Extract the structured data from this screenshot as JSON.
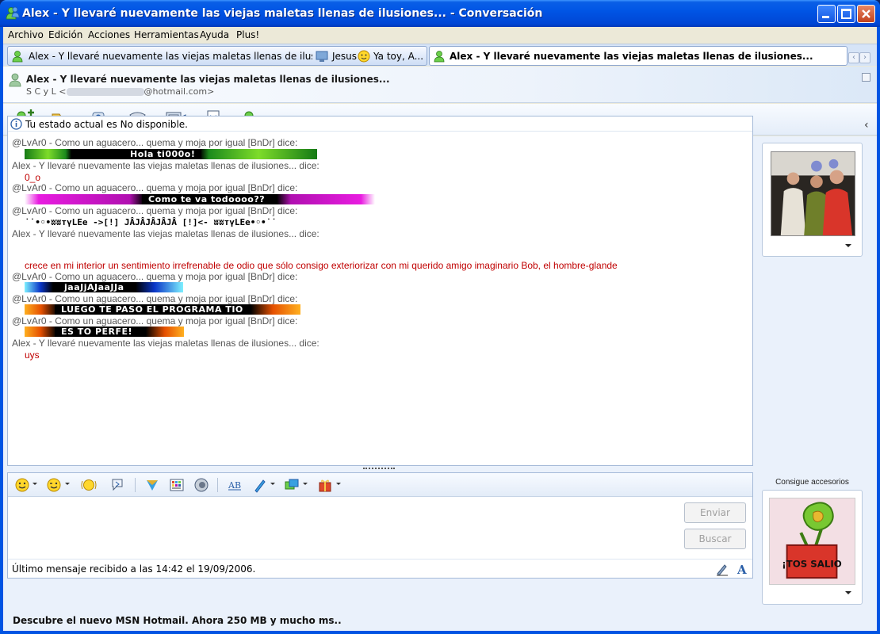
{
  "window": {
    "title": "Alex - Y llevaré nuevamente las viejas maletas llenas de ilusiones... - Conversación"
  },
  "menu": [
    "Archivo",
    "Edición",
    "Acciones",
    "Herramientas",
    "Ayuda",
    "Plus!"
  ],
  "tabs": [
    {
      "label": "Alex - Y llevaré nuevamente las viejas maletas llenas de ilusiones...,",
      "extra1": "Jesus",
      "extra2": "Ya toy, A...",
      "active": false
    },
    {
      "label": "Alex - Y llevaré nuevamente las viejas maletas llenas de ilusiones...",
      "active": true
    }
  ],
  "contact": {
    "name": "Alex - Y llevaré nuevamente las viejas maletas llenas de ilusiones...",
    "email_prefix": "S C y L",
    "email_domain": "@hotmail.com>"
  },
  "toolbar_icons": [
    "add-contact-icon",
    "send-files-icon",
    "webcam-icon",
    "call-icon",
    "video-icon",
    "activities-icon",
    "block-icon"
  ],
  "status_message": "Tu estado actual es No disponible.",
  "messages": [
    {
      "sender": "@LvAr0 - Como un aguacero... quema y moja por igual [BnDr] dice:",
      "text": "Hola ti000o!",
      "style": "green"
    },
    {
      "sender": "Alex - Y llevaré nuevamente las viejas maletas llenas de ilusiones... dice:",
      "text": "0_o",
      "style": "plain"
    },
    {
      "sender": "@LvAr0 - Como un aguacero... quema y moja por igual [BnDr] dice:",
      "text": "Como te va todoooo??",
      "style": "magenta"
    },
    {
      "sender": "@LvAr0 - Como un aguacero... quema y moja por igual [BnDr] dice:",
      "text": "˙˙•◦•ʬʬтүLEe ->[!]  JÂJÂJÂJÂJÂ  [!]<- ʬʬтүLEe•◦•˙˙",
      "style": "mono"
    },
    {
      "sender": "Alex - Y llevaré nuevamente las viejas maletas llenas de ilusiones... dice:",
      "text": "crece en mi interior un sentimiento irrefrenable de odio que sólo consigo exteriorizar con mi querido amigo imaginario Bob, el hombre-glande",
      "style": "plain"
    },
    {
      "sender": "@LvAr0 - Como un aguacero... quema y moja por igual [BnDr] dice:",
      "text": "jaaJjAJaaJJa",
      "style": "blue"
    },
    {
      "sender": "@LvAr0 - Como un aguacero... quema y moja por igual [BnDr] dice:",
      "text": "LUEGO TE PASO EL PROGRAMA TIO",
      "style": "orange"
    },
    {
      "sender": "@LvAr0 - Como un aguacero... quema y moja por igual [BnDr] dice:",
      "text": "ES TO PERFE!",
      "style": "orange"
    },
    {
      "sender": "Alex - Y llevaré nuevamente las viejas maletas llenas de ilusiones... dice:",
      "text": "uys",
      "style": "plain"
    }
  ],
  "compose": {
    "send_label": "Enviar",
    "search_label": "Buscar",
    "last_message": "Último mensaje recibido a las 14:42 el 19/09/2006."
  },
  "accessories_label": "Consigue accesorios",
  "accessory_sign": "¡TOS SALIO",
  "footer_text": "Descubre el nuevo MSN Hotmail. Ahora 250 MB y mucho ms..",
  "colors": {
    "titlebar": "#0055e5",
    "message_red": "#c00000",
    "sender_gray": "#555555"
  }
}
